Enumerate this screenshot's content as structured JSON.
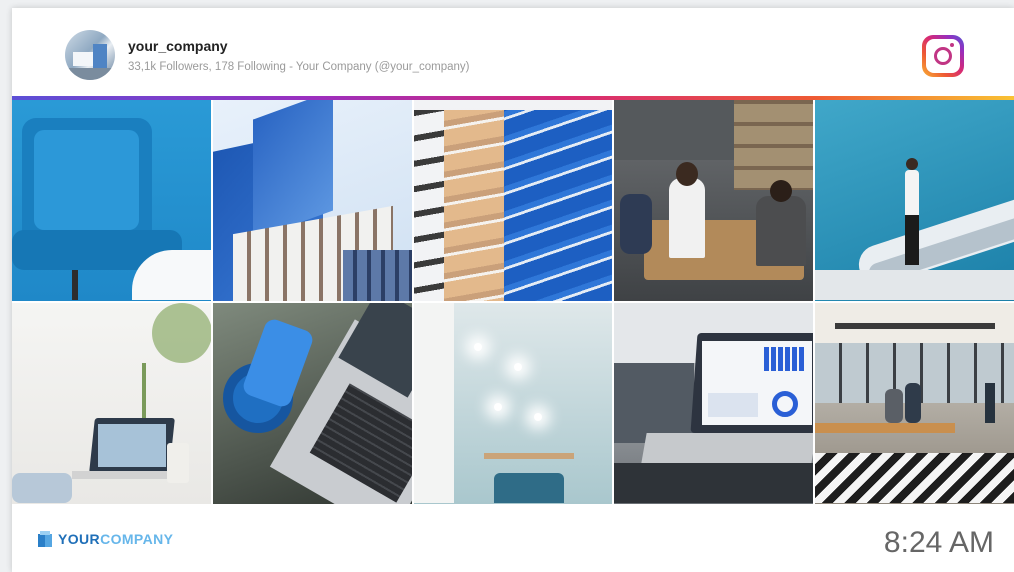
{
  "profile": {
    "username": "your_company",
    "subtitle": "33,1k Followers, 178 Following - Your Company (@your_company)"
  },
  "header": {
    "icon": "instagram-icon",
    "gradient_colors": [
      "#5b4fd6",
      "#9b2fbf",
      "#d62976",
      "#ee5a34",
      "#f9c233"
    ]
  },
  "grid": {
    "photos": [
      {
        "subject": "blue-chair"
      },
      {
        "subject": "glass-building"
      },
      {
        "subject": "blue-pencils"
      },
      {
        "subject": "team-meeting"
      },
      {
        "subject": "escalator"
      },
      {
        "subject": "laptop-on-desk"
      },
      {
        "subject": "headphones-and-laptop"
      },
      {
        "subject": "wall-lamps"
      },
      {
        "subject": "laptop-charts"
      },
      {
        "subject": "open-office"
      }
    ]
  },
  "footer": {
    "logo_part1": "YOUR",
    "logo_part2": "COMPANY",
    "time": "8:24 AM",
    "brand_colors": [
      "#1f6fb8",
      "#66b6ea"
    ]
  }
}
